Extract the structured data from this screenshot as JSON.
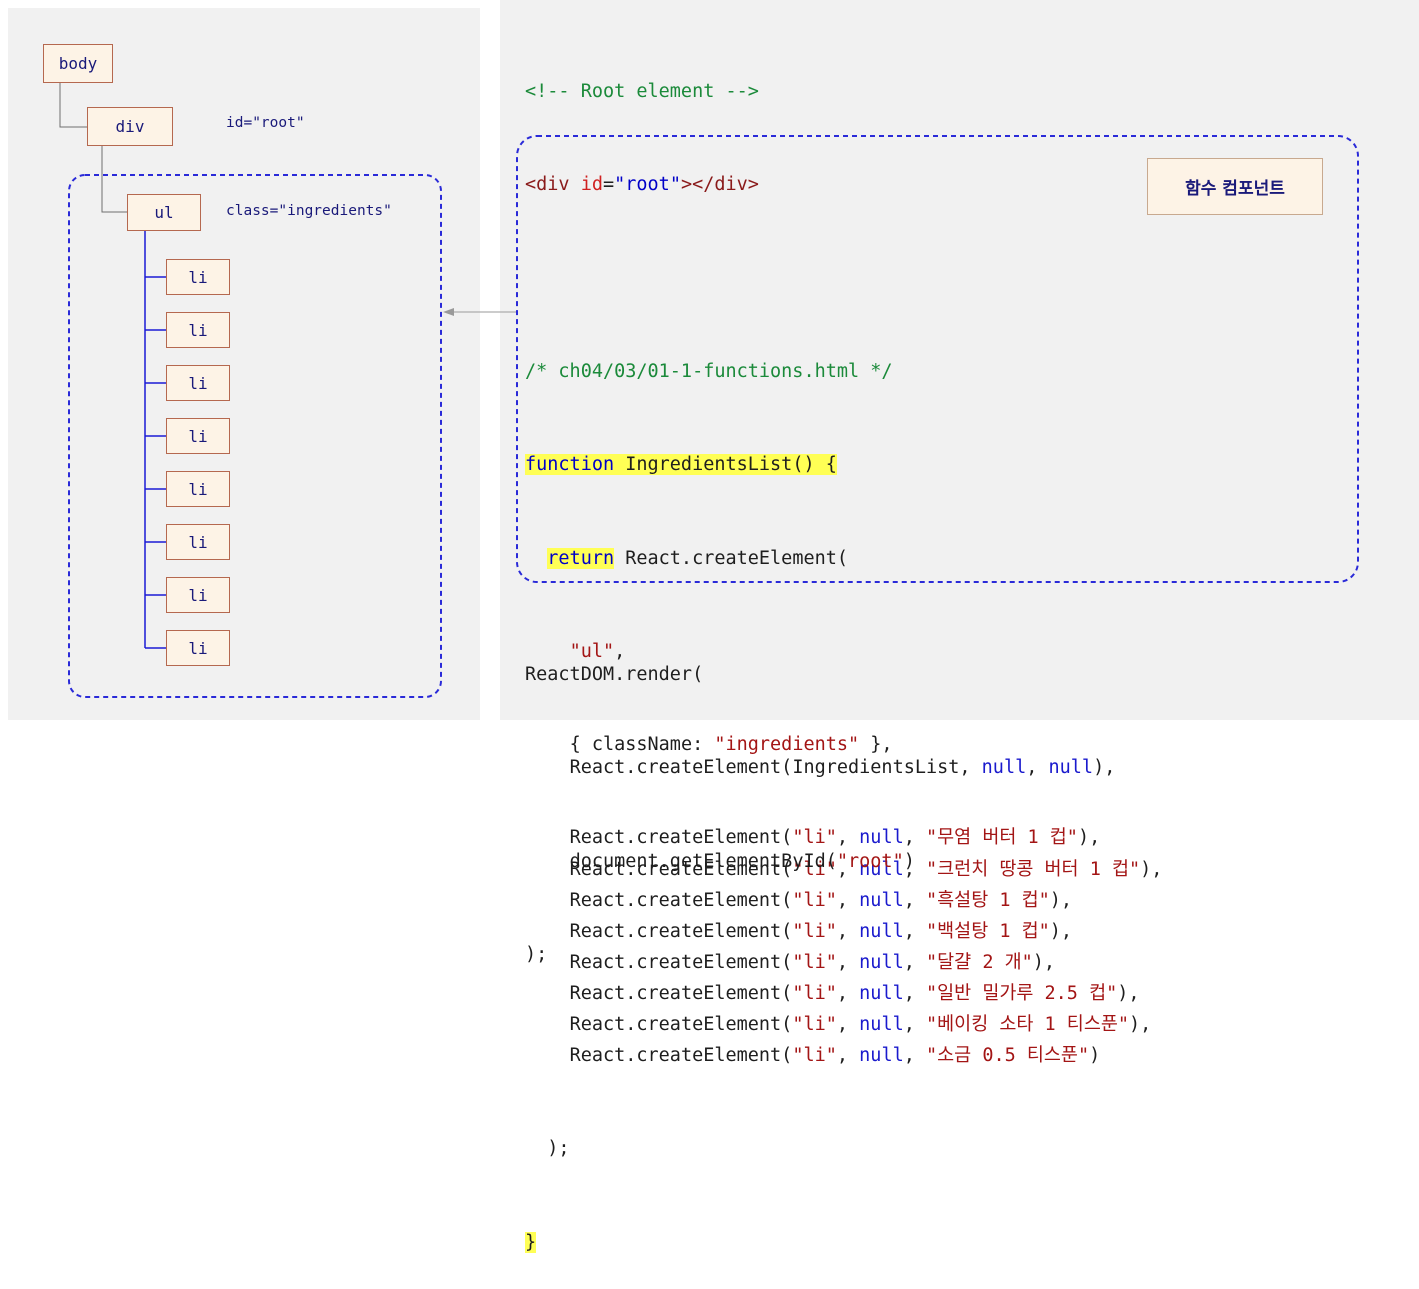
{
  "tree": {
    "body_label": "body",
    "div_label": "div",
    "div_attr": "id=\"root\"",
    "ul_label": "ul",
    "ul_attr": "class=\"ingredients\"",
    "li_labels": [
      "li",
      "li",
      "li",
      "li",
      "li",
      "li",
      "li",
      "li"
    ]
  },
  "code": {
    "comment_root": "<!-- Root element -->",
    "div_open": "<div",
    "div_attr_name": "id",
    "div_eq": "=",
    "div_attr_value": "\"root\"",
    "div_close": "></div>",
    "file_comment": "/* ch04/03/01-1-functions.html */",
    "fn_keyword": "function",
    "fn_signature": " IngredientsList() {",
    "return_kw": "return",
    "create_call": " React.createElement(",
    "ul_string": "\"ul\"",
    "comma": ",",
    "props_open": "{ className: ",
    "props_value": "\"ingredients\"",
    "props_close": " },",
    "li_prefix": "React.createElement(",
    "li_string": "\"li\"",
    "null_kw": "null",
    "items": [
      "\"무염 버터 1 컵\"",
      "\"크런치 땅콩 버터 1 컵\"",
      "\"흑설탕 1 컵\"",
      "\"백설탕 1 컵\"",
      "\"달걀 2 개\"",
      "\"일반 밀가루 2.5 컵\"",
      "\"베이킹 소타 1 티스푼\"",
      "\"소금 0.5 티스푼\""
    ],
    "close_paren": ");",
    "close_brace": "}",
    "render_call": "ReactDOM.render(",
    "render_arg_prefix": "React.createElement(IngredientsList, ",
    "get_element_prefix": "document.getElementById(",
    "root_string": "\"root\"",
    "render_close": ");"
  },
  "badge_label": "함수 컴포넌트",
  "colors": {
    "node_fill": "#fdf3e6",
    "node_border": "#b5684f",
    "tree_line_blue": "#1a1ad6",
    "dashed_border": "#2a2ad8",
    "highlight": "#ffff55",
    "string": "#a31515",
    "keyword": "#0000c8",
    "comment": "#1b8a3a"
  }
}
